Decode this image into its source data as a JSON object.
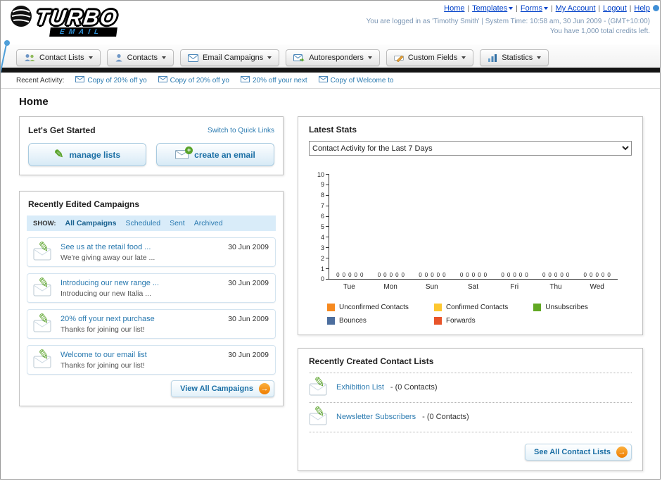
{
  "header": {
    "logo_turbo": "TURBO",
    "logo_email": "EMAIL",
    "separator": "|",
    "links": [
      {
        "label": "Home"
      },
      {
        "label": "Templates"
      },
      {
        "label": "Forms"
      },
      {
        "label": "My Account"
      },
      {
        "label": "Logout"
      },
      {
        "label": "Help"
      }
    ],
    "login_info": "You are logged in as 'Timothy Smith' | System Time: 10:58 am, 30 Jun 2009 - (GMT+10:00)",
    "credits_line": "You have 1,000 total credits left."
  },
  "nav": {
    "tabs": [
      {
        "label": "Contact Lists"
      },
      {
        "label": "Contacts"
      },
      {
        "label": "Email Campaigns"
      },
      {
        "label": "Autoresponders"
      },
      {
        "label": "Custom Fields"
      },
      {
        "label": "Statistics"
      }
    ]
  },
  "recent_activity": {
    "label": "Recent Activity:",
    "items": [
      {
        "label": "Copy of 20% off yo"
      },
      {
        "label": "Copy of 20% off yo"
      },
      {
        "label": "20% off your next"
      },
      {
        "label": "Copy of Welcome to"
      }
    ]
  },
  "page_title": "Home",
  "icons": {
    "pencil": "✎",
    "plus": "+",
    "arrow": "→"
  },
  "get_started": {
    "title": "Let's Get Started",
    "switch_link": "Switch to Quick Links",
    "manage_lists_label": "manage lists",
    "create_email_label": "create an email"
  },
  "campaigns": {
    "title": "Recently Edited Campaigns",
    "show_label": "SHOW:",
    "filters": [
      {
        "label": "All Campaigns"
      },
      {
        "label": "Scheduled"
      },
      {
        "label": "Sent"
      },
      {
        "label": "Archived"
      }
    ],
    "items": [
      {
        "title": "See us at the retail food ...",
        "subtitle": "We're giving away our late ...",
        "date": "30 Jun 2009"
      },
      {
        "title": "Introducing our new range ...",
        "subtitle": "Introducing our new Italia ...",
        "date": "30 Jun 2009"
      },
      {
        "title": "20% off your next purchase",
        "subtitle": "Thanks for joining our list!",
        "date": "30 Jun 2009"
      },
      {
        "title": "Welcome to our email list",
        "subtitle": "Thanks for joining our list!",
        "date": "30 Jun 2009"
      }
    ],
    "view_all_label": "View All Campaigns"
  },
  "stats": {
    "title": "Latest Stats",
    "selected_option": "Contact Activity for the Last 7 Days"
  },
  "chart_data": {
    "type": "bar",
    "title": "Contact Activity for the Last 7 Days",
    "categories": [
      "Tue",
      "Mon",
      "Sun",
      "Sat",
      "Fri",
      "Thu",
      "Wed"
    ],
    "series": [
      {
        "name": "Unconfirmed Contacts",
        "color": "#f6891f",
        "values": [
          0,
          0,
          0,
          0,
          0,
          0,
          0
        ]
      },
      {
        "name": "Confirmed Contacts",
        "color": "#fdc72f",
        "values": [
          0,
          0,
          0,
          0,
          0,
          0,
          0
        ]
      },
      {
        "name": "Unsubscribes",
        "color": "#61a823",
        "values": [
          0,
          0,
          0,
          0,
          0,
          0,
          0
        ]
      },
      {
        "name": "Bounces",
        "color": "#4c6e9e",
        "values": [
          0,
          0,
          0,
          0,
          0,
          0,
          0
        ]
      },
      {
        "name": "Forwards",
        "color": "#e8542a",
        "values": [
          0,
          0,
          0,
          0,
          0,
          0,
          0
        ]
      }
    ],
    "ylim": [
      0,
      10
    ],
    "ytick_step": 1,
    "xlabel": "",
    "ylabel": "",
    "grid": false,
    "legend_position": "bottom"
  },
  "contact_lists": {
    "title": "Recently Created Contact Lists",
    "items": [
      {
        "name": "Exhibition List",
        "detail": "- (0 Contacts)"
      },
      {
        "name": "Newsletter Subscribers",
        "detail": "- (0 Contacts)"
      }
    ],
    "see_all_label": "See All Contact Lists"
  }
}
